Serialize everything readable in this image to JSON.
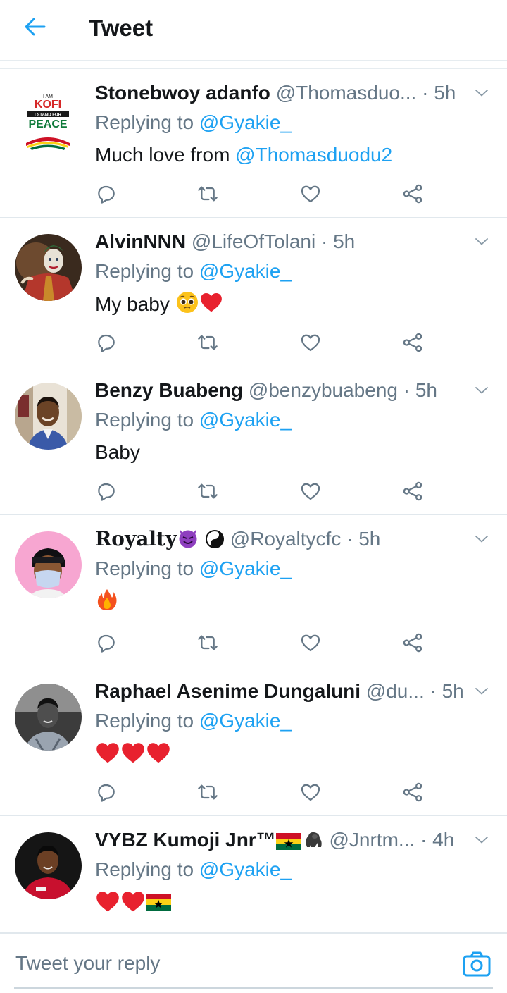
{
  "header": {
    "title": "Tweet"
  },
  "tweets": [
    {
      "name": "Stonebwoy adanfo",
      "handle": "@Thomasduo...",
      "time": "5h",
      "replying_prefix": "Replying to ",
      "replying_to": "@Gyakie_",
      "text": "Much love from ",
      "text_mention": "@Thomasduodu2"
    },
    {
      "name": "AlvinNNN",
      "handle": "@LifeOfTolani",
      "time": "5h",
      "replying_prefix": "Replying to ",
      "replying_to": "@Gyakie_",
      "text": "My baby "
    },
    {
      "name": "Benzy Buabeng",
      "handle": "@benzybuabeng",
      "time": "5h",
      "replying_prefix": "Replying to ",
      "replying_to": "@Gyakie_",
      "text": "Baby"
    },
    {
      "name": "Royalty",
      "handle": "@Royaltycfc",
      "time": "5h",
      "replying_prefix": "Replying to ",
      "replying_to": "@Gyakie_",
      "text": ""
    },
    {
      "name": "Raphael Asenime Dungaluni",
      "handle": "@du...",
      "time": "5h",
      "replying_prefix": "Replying to ",
      "replying_to": "@Gyakie_",
      "text": ""
    },
    {
      "name": "VYBZ Kumoji Jnr™",
      "handle": "@Jnrtm...",
      "time": "4h",
      "replying_prefix": "Replying to ",
      "replying_to": "@Gyakie_",
      "text": ""
    }
  ],
  "reply_bar": {
    "placeholder": "Tweet your reply"
  },
  "avatar_logo": {
    "line1": "I AM",
    "line2": "KOFI",
    "line3": "I STAND FOR",
    "line4": "PEACE"
  },
  "colors": {
    "accent": "#1da1f2",
    "secondary_text": "#657786",
    "primary_text": "#14171a",
    "divider": "#e1e8ed"
  },
  "icons": {
    "back": "arrow-left-icon",
    "caret": "chevron-down-icon",
    "reply": "comment-icon",
    "retweet": "retweet-icon",
    "like": "heart-icon",
    "share": "share-icon",
    "camera": "camera-icon"
  }
}
